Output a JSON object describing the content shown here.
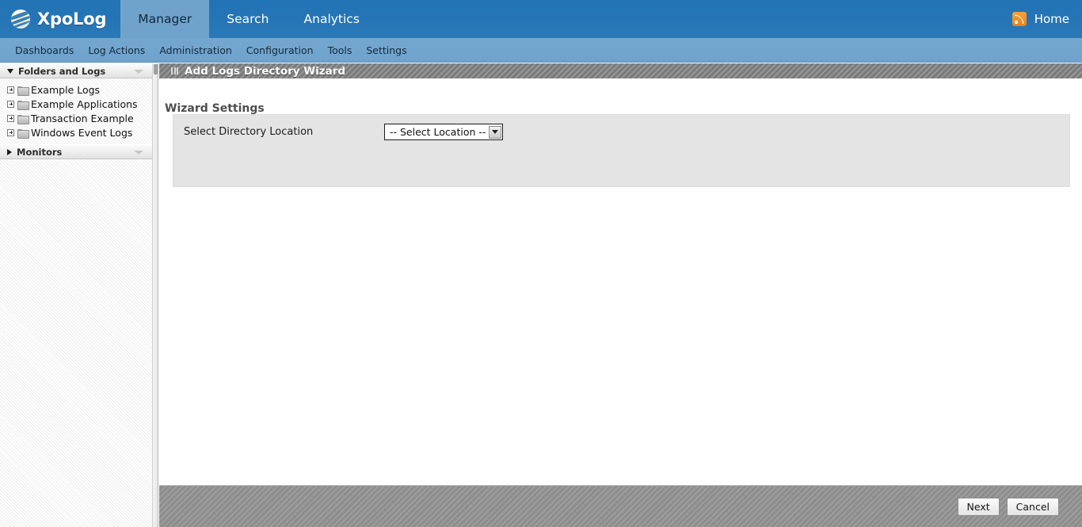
{
  "topbar": {
    "brand": "XpoLog",
    "logo_icon": "xpolog-globe-icon",
    "tabs": [
      {
        "label": "Manager",
        "active": true
      },
      {
        "label": "Search",
        "active": false
      },
      {
        "label": "Analytics",
        "active": false
      }
    ],
    "rss_icon": "rss-feed-icon",
    "home_label": "Home",
    "accent_color": "#2274b5",
    "active_tab_color": "#6fa3cc"
  },
  "subnav": {
    "items": [
      {
        "label": "Dashboards"
      },
      {
        "label": "Log Actions"
      },
      {
        "label": "Administration"
      },
      {
        "label": "Configuration"
      },
      {
        "label": "Tools"
      },
      {
        "label": "Settings"
      }
    ]
  },
  "sidebar": {
    "sections": [
      {
        "title": "Folders and Logs",
        "expanded": true,
        "collapse_icon": "chevron-down-icon"
      },
      {
        "title": "Monitors",
        "expanded": false,
        "collapse_icon": "chevron-down-icon"
      }
    ],
    "tree": [
      {
        "label": "Example Logs",
        "expand_icon": "plus-box-icon",
        "icon": "folder-icon"
      },
      {
        "label": "Example Applications",
        "expand_icon": "plus-box-icon",
        "icon": "folder-icon"
      },
      {
        "label": "Transaction Example",
        "expand_icon": "plus-box-icon",
        "icon": "folder-icon"
      },
      {
        "label": "Windows Event Logs",
        "expand_icon": "plus-box-icon",
        "icon": "folder-icon"
      }
    ]
  },
  "main": {
    "panel_title": "Add Logs Directory Wizard",
    "panel_grip_icon": "drag-grip-icon",
    "section_heading": "Wizard Settings",
    "form": {
      "field_label": "Select Directory Location",
      "select_value": "-- Select Location --",
      "select_arrow_icon": "chevron-down-icon"
    }
  },
  "footer": {
    "next_label": "Next",
    "cancel_label": "Cancel"
  }
}
